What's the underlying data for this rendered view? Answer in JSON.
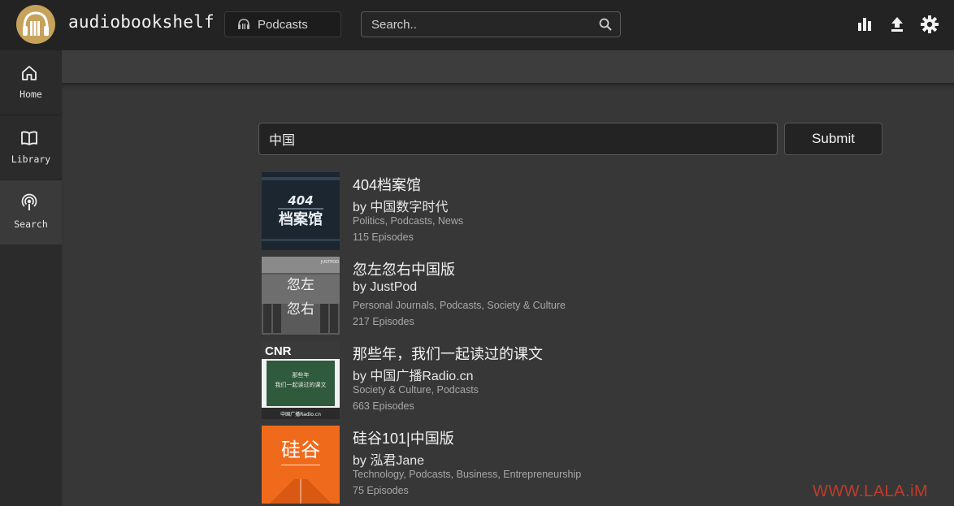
{
  "app": {
    "title": "audiobookshelf"
  },
  "header": {
    "library_label": "Podcasts",
    "search_placeholder": "Search..",
    "icons": [
      "stats-icon",
      "upload-icon",
      "settings-icon"
    ]
  },
  "sidebar": {
    "items": [
      {
        "label": "Home",
        "icon": "home-icon"
      },
      {
        "label": "Library",
        "icon": "book-icon"
      },
      {
        "label": "Search",
        "icon": "podcast-icon"
      }
    ]
  },
  "search": {
    "query": "中国",
    "submit_label": "Submit"
  },
  "results": [
    {
      "title": "404档案馆",
      "author": "by 中国数字时代",
      "genres": "Politics, Podcasts, News",
      "episodes": "115 Episodes",
      "cover_text": "404\n档案馆"
    },
    {
      "title": "忽左忽右中国版",
      "author": "by JustPod",
      "genres": "Personal Journals, Podcasts, Society & Culture",
      "episodes": "217 Episodes",
      "cover_text": "忽左\n忽右"
    },
    {
      "title": "那些年，我们一起读过的课文",
      "author": "by 中国广播Radio.cn",
      "genres": "Society & Culture, Podcasts",
      "episodes": "663 Episodes",
      "cover_text": "CNR"
    },
    {
      "title": "硅谷101|中国版",
      "author": "by 泓君Jane",
      "genres": "Technology, Podcasts, Business, Entrepreneurship",
      "episodes": "75 Episodes",
      "cover_text": "硅谷"
    }
  ],
  "watermark": "WWW.LALA.iM",
  "colors": {
    "accent_logo": "#c6a25a",
    "cover4_bg": "#f06a1c",
    "watermark": "#c03b2a"
  }
}
